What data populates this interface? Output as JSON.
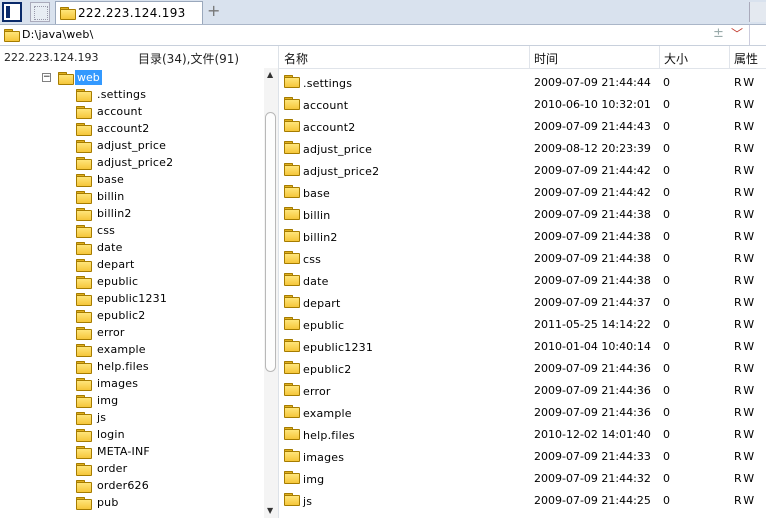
{
  "tabs": [
    {
      "label": "222.223.124.193"
    }
  ],
  "toolbar": {
    "add_tab": "+"
  },
  "path": {
    "value": "D:\\java\\web\\",
    "plus": "±",
    "dropdown": "﹀"
  },
  "left_header": {
    "host": "222.223.124.193",
    "counts": "目录(34),文件(91)"
  },
  "tree": {
    "root": {
      "expander": "−",
      "label": "web"
    },
    "items": [
      ".settings",
      "account",
      "account2",
      "adjust_price",
      "adjust_price2",
      "base",
      "billin",
      "billin2",
      "css",
      "date",
      "depart",
      "epublic",
      "epublic1231",
      "epublic2",
      "error",
      "example",
      "help.files",
      "images",
      "img",
      "js",
      "login",
      "META-INF",
      "order",
      "order626",
      "pub"
    ]
  },
  "columns": {
    "name": "名称",
    "time": "时间",
    "size": "大小",
    "attr": "属性"
  },
  "rows": [
    {
      "name": ".settings",
      "time": "2009-07-09 21:44:44",
      "size": "0",
      "attr": "RW"
    },
    {
      "name": "account",
      "time": "2010-06-10 10:32:01",
      "size": "0",
      "attr": "RW"
    },
    {
      "name": "account2",
      "time": "2009-07-09 21:44:43",
      "size": "0",
      "attr": "RW"
    },
    {
      "name": "adjust_price",
      "time": "2009-08-12 20:23:39",
      "size": "0",
      "attr": "RW"
    },
    {
      "name": "adjust_price2",
      "time": "2009-07-09 21:44:42",
      "size": "0",
      "attr": "RW"
    },
    {
      "name": "base",
      "time": "2009-07-09 21:44:42",
      "size": "0",
      "attr": "RW"
    },
    {
      "name": "billin",
      "time": "2009-07-09 21:44:38",
      "size": "0",
      "attr": "RW"
    },
    {
      "name": "billin2",
      "time": "2009-07-09 21:44:38",
      "size": "0",
      "attr": "RW"
    },
    {
      "name": "css",
      "time": "2009-07-09 21:44:38",
      "size": "0",
      "attr": "RW"
    },
    {
      "name": "date",
      "time": "2009-07-09 21:44:38",
      "size": "0",
      "attr": "RW"
    },
    {
      "name": "depart",
      "time": "2009-07-09 21:44:37",
      "size": "0",
      "attr": "RW"
    },
    {
      "name": "epublic",
      "time": "2011-05-25 14:14:22",
      "size": "0",
      "attr": "RW"
    },
    {
      "name": "epublic1231",
      "time": "2010-01-04 10:40:14",
      "size": "0",
      "attr": "RW"
    },
    {
      "name": "epublic2",
      "time": "2009-07-09 21:44:36",
      "size": "0",
      "attr": "RW"
    },
    {
      "name": "error",
      "time": "2009-07-09 21:44:36",
      "size": "0",
      "attr": "RW"
    },
    {
      "name": "example",
      "time": "2009-07-09 21:44:36",
      "size": "0",
      "attr": "RW"
    },
    {
      "name": "help.files",
      "time": "2010-12-02 14:01:40",
      "size": "0",
      "attr": "RW"
    },
    {
      "name": "images",
      "time": "2009-07-09 21:44:33",
      "size": "0",
      "attr": "RW"
    },
    {
      "name": "img",
      "time": "2009-07-09 21:44:32",
      "size": "0",
      "attr": "RW"
    },
    {
      "name": "js",
      "time": "2009-07-09 21:44:25",
      "size": "0",
      "attr": "RW"
    }
  ],
  "colors": {
    "selection": "#3399ff",
    "folder": "#f5c63a",
    "tab_strip": "#d9e2ee"
  }
}
